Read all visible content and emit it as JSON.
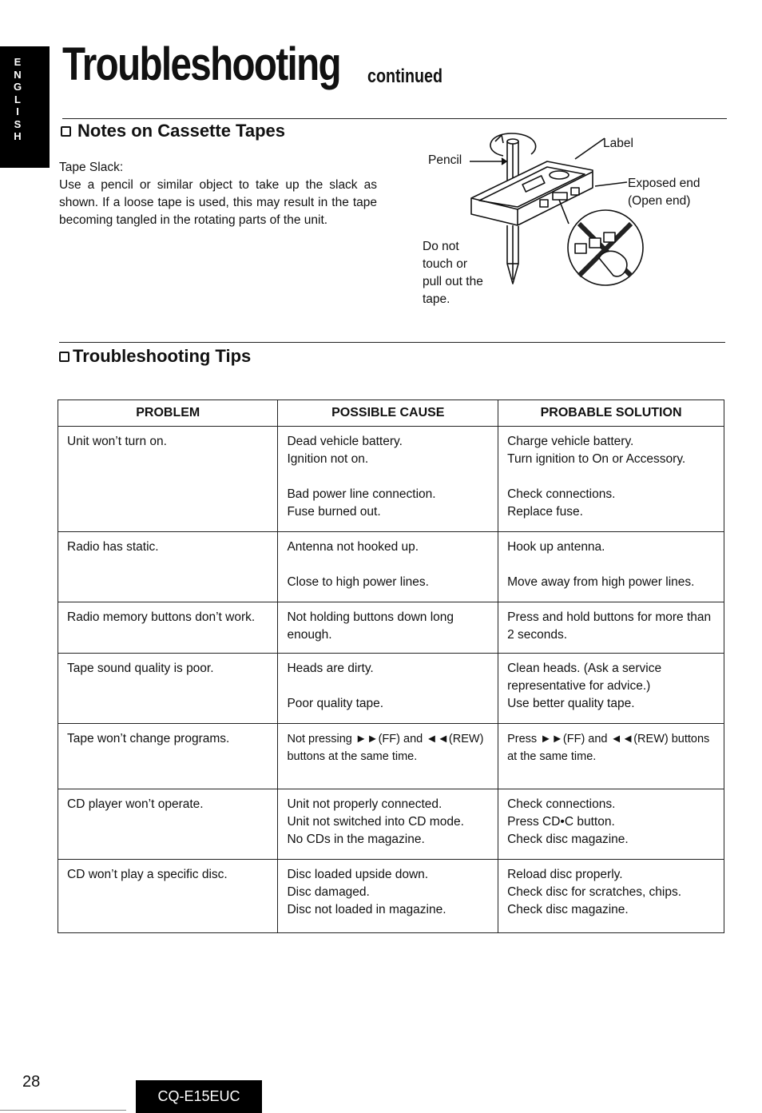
{
  "language_tab": [
    "E",
    "N",
    "G",
    "L",
    "I",
    "S",
    "H"
  ],
  "header": {
    "title": "Troubleshooting",
    "suffix": "continued"
  },
  "notes_section": {
    "heading": "Notes on Cassette Tapes",
    "subtitle": "Tape Slack:",
    "body": "Use a pencil or similar object to take up the slack as shown. If a loose tape is used, this may result in the tape becoming tangled in the rotating parts of the unit.",
    "figure_labels": {
      "pencil": "Pencil",
      "label": "Label",
      "exposed_end": "Exposed end",
      "open_end": "(Open end)",
      "warning": [
        "Do not",
        "touch or",
        "pull out the",
        "tape."
      ]
    }
  },
  "tips_section": {
    "heading": "Troubleshooting Tips",
    "columns": [
      "PROBLEM",
      "POSSIBLE CAUSE",
      "PROBABLE SOLUTION"
    ],
    "rows": [
      {
        "problem": "Unit won’t turn on.",
        "causes": [
          [
            "Dead vehicle battery.",
            "Ignition not on."
          ],
          [
            "Bad power line connection.",
            "Fuse burned out."
          ]
        ],
        "solutions": [
          [
            "Charge vehicle battery.",
            "Turn ignition to On or Accessory."
          ],
          [
            "Check connections.",
            "Replace fuse."
          ]
        ]
      },
      {
        "problem": "Radio has static.",
        "causes": [
          [
            "Antenna not hooked up."
          ],
          [
            "Close to high power lines."
          ]
        ],
        "solutions": [
          [
            "Hook up antenna."
          ],
          [
            "Move away from high power lines."
          ]
        ]
      },
      {
        "problem": "Radio memory buttons don’t work.",
        "causes": [
          [
            "Not holding buttons down long enough."
          ]
        ],
        "solutions": [
          [
            "Press and hold buttons for more than 2 seconds."
          ]
        ]
      },
      {
        "problem": "Tape sound quality is poor.",
        "causes": [
          [
            "Heads are dirty."
          ],
          [
            "Poor quality tape."
          ]
        ],
        "solutions": [
          [
            "Clean heads. (Ask a service representative for advice.)",
            "Use better quality tape."
          ]
        ]
      },
      {
        "problem": "Tape won’t change programs.",
        "causes": [
          [
            "Not pressing ►►(FF) and ◄◄(REW) buttons at the same time."
          ]
        ],
        "solutions": [
          [
            "Press ►►(FF) and ◄◄(REW) buttons at the same time."
          ]
        ]
      },
      {
        "problem": "CD player won’t operate.",
        "causes": [
          [
            "Unit not properly connected.",
            "Unit not switched into CD mode.",
            "No CDs in the magazine."
          ]
        ],
        "solutions": [
          [
            "Check connections.",
            "Press CD•C button.",
            "Check disc magazine."
          ]
        ]
      },
      {
        "problem": "CD won’t play a specific disc.",
        "causes": [
          [
            "Disc loaded upside down.",
            "Disc damaged.",
            "Disc not loaded in magazine."
          ]
        ],
        "solutions": [
          [
            "Reload disc properly.",
            "Check disc for scratches, chips.",
            "Check disc magazine."
          ]
        ]
      }
    ]
  },
  "footer": {
    "page_number": "28",
    "model": "CQ-E15EUC"
  }
}
